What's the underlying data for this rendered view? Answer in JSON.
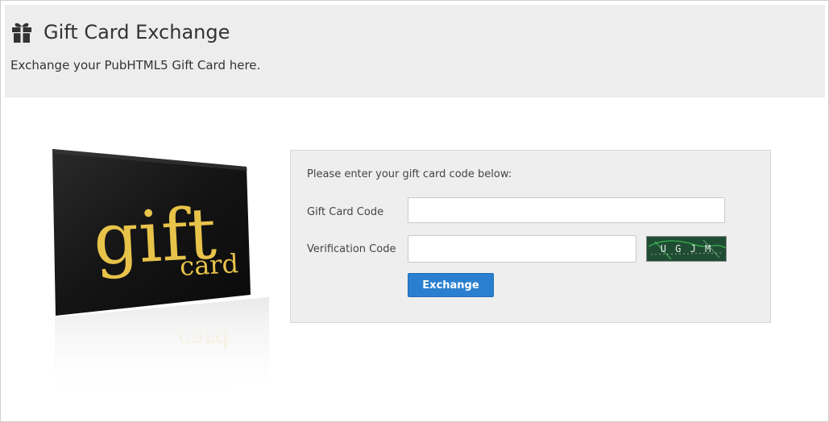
{
  "header": {
    "icon": "gift-icon",
    "title": "Gift Card Exchange",
    "subtitle": "Exchange your PubHTML5 Gift Card here."
  },
  "card_image": {
    "word_large": "gift",
    "word_small": "card",
    "colors": {
      "card": "#1a1a1a",
      "lettering": "#e8c34a"
    }
  },
  "form": {
    "prompt": "Please enter your gift card code below:",
    "gift_card_code": {
      "label": "Gift Card Code",
      "value": "",
      "placeholder": ""
    },
    "verification_code": {
      "label": "Verification Code",
      "value": "",
      "placeholder": ""
    },
    "captcha": {
      "text": "U G J M"
    },
    "exchange_button": {
      "label": "Exchange",
      "color": "#2a7fd0"
    }
  },
  "colors": {
    "header_bg": "#ededed",
    "panel_bg": "#eeeeee"
  }
}
